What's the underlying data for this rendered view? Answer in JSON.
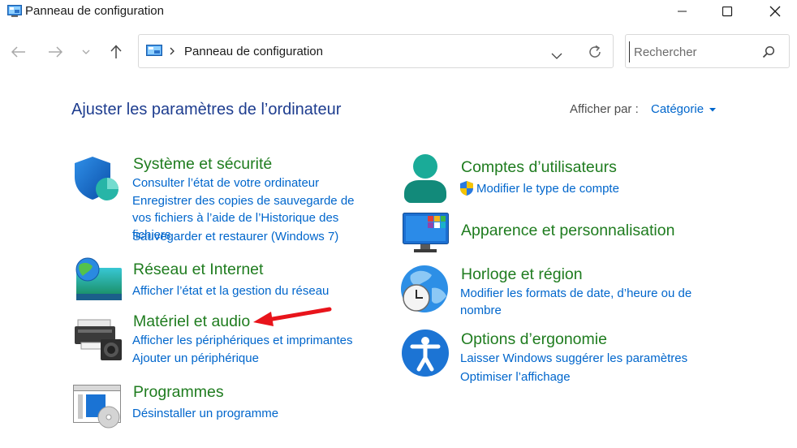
{
  "window": {
    "title": "Panneau de configuration"
  },
  "address_bar": {
    "path": "Panneau de configuration"
  },
  "search": {
    "placeholder": "Rechercher"
  },
  "page": {
    "heading": "Ajuster les paramètres de l’ordinateur",
    "view_by_label": "Afficher par :",
    "view_by_value": "Catégorie"
  },
  "categories": {
    "system_security": {
      "title": "Système et sécurité",
      "links": [
        "Consulter l’état de votre ordinateur",
        "Enregistrer des copies de sauvegarde de vos fichiers à l’aide de l’Historique des fichiers",
        "Sauvegarder et restaurer (Windows 7)"
      ]
    },
    "network": {
      "title": "Réseau et Internet",
      "links": [
        "Afficher l’état et la gestion du réseau"
      ]
    },
    "hardware": {
      "title": "Matériel et audio",
      "links": [
        "Afficher les périphériques et imprimantes",
        "Ajouter un périphérique"
      ]
    },
    "programs": {
      "title": "Programmes",
      "links": [
        "Désinstaller un programme"
      ]
    },
    "user_accounts": {
      "title": "Comptes d’utilisateurs",
      "links": [
        "Modifier le type de compte"
      ]
    },
    "appearance": {
      "title": "Apparence et personnalisation",
      "links": []
    },
    "clock_region": {
      "title": "Horloge et région",
      "links": [
        "Modifier les formats de date, d’heure ou de nombre"
      ]
    },
    "ease_of_access": {
      "title": "Options d’ergonomie",
      "links": [
        "Laisser Windows suggérer les paramètres",
        "Optimiser l’affichage"
      ]
    }
  },
  "annotation": {
    "arrow_color": "#e8141b"
  }
}
